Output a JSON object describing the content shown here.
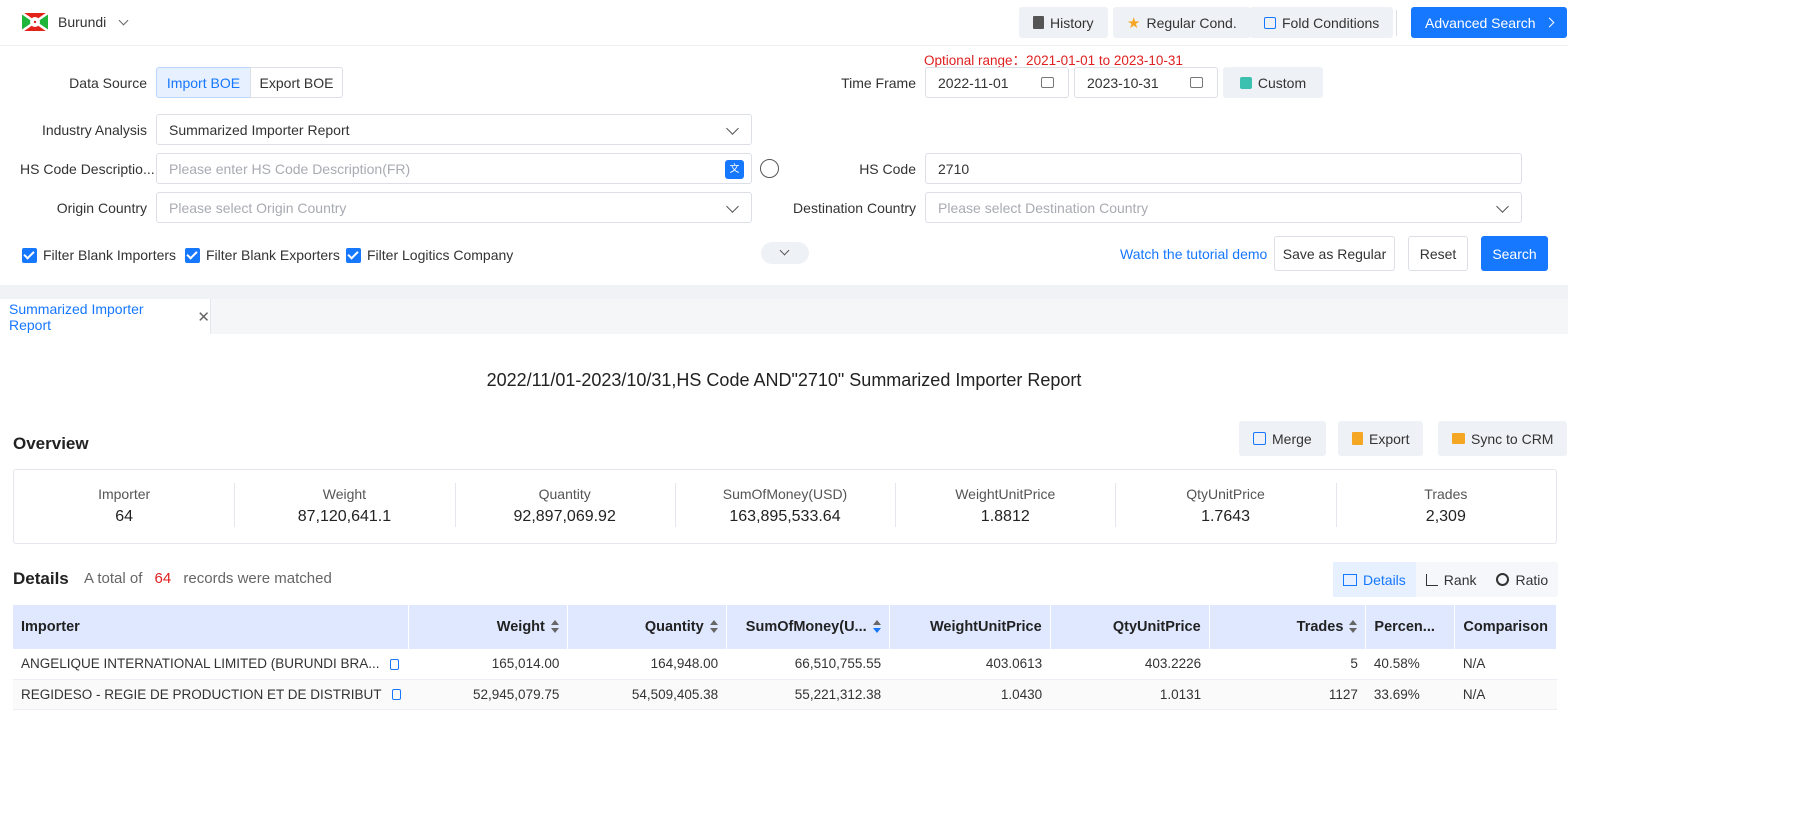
{
  "topbar": {
    "country": "Burundi",
    "history_label": "History",
    "regular_label": "Regular Cond.",
    "fold_label": "Fold Conditions",
    "advanced_label": "Advanced Search"
  },
  "form": {
    "optional_range": "Optional range：2021-01-01 to 2023-10-31",
    "data_source_label": "Data Source",
    "import_boe": "Import BOE",
    "export_boe": "Export BOE",
    "time_frame_label": "Time Frame",
    "date_from": "2022-11-01",
    "date_to": "2023-10-31",
    "custom_label": "Custom",
    "industry_label": "Industry Analysis",
    "industry_value": "Summarized Importer Report",
    "hs_desc_label": "HS Code Descriptio...",
    "hs_desc_placeholder": "Please enter HS Code Description(FR)",
    "hs_code_label": "HS Code",
    "hs_code_value": "2710",
    "origin_label": "Origin Country",
    "origin_placeholder": "Please select Origin Country",
    "dest_label": "Destination Country",
    "dest_placeholder": "Please select Destination Country",
    "filter_importers": "Filter Blank Importers",
    "filter_exporters": "Filter Blank Exporters",
    "filter_logistics": "Filter Logitics Company",
    "tutorial_link": "Watch the tutorial demo",
    "save_regular": "Save as Regular",
    "reset": "Reset",
    "search": "Search"
  },
  "tab": {
    "label": "Summarized Importer Report"
  },
  "report": {
    "title": "2022/11/01-2023/10/31,HS Code AND\"2710\" Summarized Importer Report",
    "overview_label": "Overview",
    "merge": "Merge",
    "export": "Export",
    "sync": "Sync to CRM",
    "stats": [
      {
        "key": "Importer",
        "value": "64"
      },
      {
        "key": "Weight",
        "value": "87,120,641.1"
      },
      {
        "key": "Quantity",
        "value": "92,897,069.92"
      },
      {
        "key": "SumOfMoney(USD)",
        "value": "163,895,533.64"
      },
      {
        "key": "WeightUnitPrice",
        "value": "1.8812"
      },
      {
        "key": "QtyUnitPrice",
        "value": "1.7643"
      },
      {
        "key": "Trades",
        "value": "2,309"
      }
    ],
    "details_label": "Details",
    "matched_prefix": "A total of",
    "matched_count": "64",
    "matched_suffix": "records were matched",
    "view_details": "Details",
    "view_rank": "Rank",
    "view_ratio": "Ratio",
    "columns": [
      "Importer",
      "Weight",
      "Quantity",
      "SumOfMoney(U...",
      "WeightUnitPrice",
      "QtyUnitPrice",
      "Trades",
      "Percen...",
      "Comparison"
    ],
    "rows": [
      [
        "ANGELIQUE INTERNATIONAL LIMITED (BURUNDI BRA...",
        "165,014.00",
        "164,948.00",
        "66,510,755.55",
        "403.0613",
        "403.2226",
        "5",
        "40.58%",
        "N/A"
      ],
      [
        "REGIDESO - REGIE DE PRODUCTION ET DE DISTRIBUT",
        "52,945,079.75",
        "54,509,405.38",
        "55,221,312.38",
        "1.0430",
        "1.0131",
        "1127",
        "33.69%",
        "N/A"
      ]
    ]
  },
  "colors": {
    "accent": "#1677ff",
    "header_bg": "#dfe8ff",
    "red": "#e02020"
  }
}
